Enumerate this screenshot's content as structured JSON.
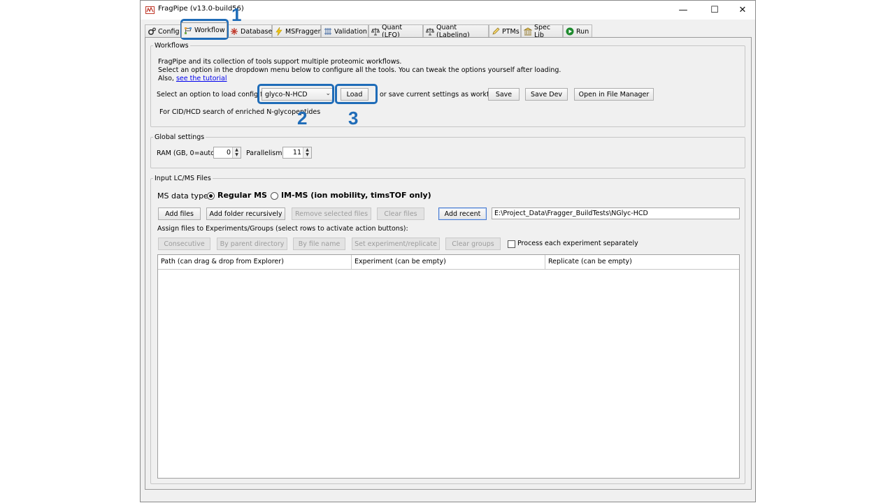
{
  "window": {
    "title": "FragPipe (v13.0-build56)",
    "controls": {
      "minimize": "—",
      "maximize": "☐",
      "close": "✕"
    }
  },
  "tabs": [
    {
      "label": "Config",
      "icon": "gear-icon",
      "selected": false
    },
    {
      "label": "Workflow",
      "icon": "workflow-icon",
      "selected": true
    },
    {
      "label": "Database",
      "icon": "database-icon",
      "selected": false
    },
    {
      "label": "MSFragger",
      "icon": "lightning-icon",
      "selected": false
    },
    {
      "label": "Validation",
      "icon": "validation-icon",
      "selected": false
    },
    {
      "label": "Quant (LFQ)",
      "icon": "scale-icon",
      "selected": false
    },
    {
      "label": "Quant (Labeling)",
      "icon": "scale-icon",
      "selected": false
    },
    {
      "label": "PTMs",
      "icon": "pencil-icon",
      "selected": false
    },
    {
      "label": "Spec Lib",
      "icon": "library-icon",
      "selected": false
    },
    {
      "label": "Run",
      "icon": "play-icon",
      "selected": false
    }
  ],
  "workflows": {
    "legend": "Workflows",
    "desc_line1": "FragPipe and its collection of tools support multiple proteomic workflows.",
    "desc_line2": "Select an option in the dropdown menu below to configure all the tools. You can tweak the options yourself after loading.",
    "also_prefix": "Also, ",
    "tutorial_link": "see the tutorial",
    "load_label": "Select an option to load config for:",
    "selected_workflow": "glyco-N-HCD",
    "load_button": "Load",
    "save_text": "or save current settings as workflow",
    "save_button": "Save",
    "save_dev_button": "Save Dev",
    "open_fm_button": "Open in File Manager",
    "workflow_description": "For CID/HCD search of enriched N-glycopeptides"
  },
  "global_settings": {
    "legend": "Global settings",
    "ram_label": "RAM (GB, 0=auto)",
    "ram_value": "0",
    "parallelism_label": "Parallelism",
    "parallelism_value": "11"
  },
  "input_files": {
    "legend": "Input LC/MS Files",
    "ms_type_label": "MS data type",
    "regular_ms": "Regular MS",
    "im_ms": "IM-MS (ion mobility, timsTOF only)",
    "add_files": "Add files",
    "add_folder": "Add folder recursively",
    "remove_selected": "Remove selected files",
    "clear_files": "Clear files",
    "add_recent": "Add recent",
    "recent_path": "E:\\Project_Data\\Fragger_BuildTests\\NGlyc-HCD",
    "assign_text": "Assign files to Experiments/Groups (select rows to activate action buttons):",
    "consecutive": "Consecutive",
    "by_parent": "By parent directory",
    "by_file_name": "By file name",
    "set_exp": "Set experiment/replicate",
    "clear_groups": "Clear groups",
    "process_separately": "Process each experiment separately",
    "columns": [
      "Path (can drag & drop from Explorer)",
      "Experiment (can be empty)",
      "Replicate (can be empty)"
    ]
  },
  "annotations": [
    "1",
    "2",
    "3"
  ],
  "colors": {
    "annotation": "#1f6cb8",
    "link": "#0000ee"
  }
}
